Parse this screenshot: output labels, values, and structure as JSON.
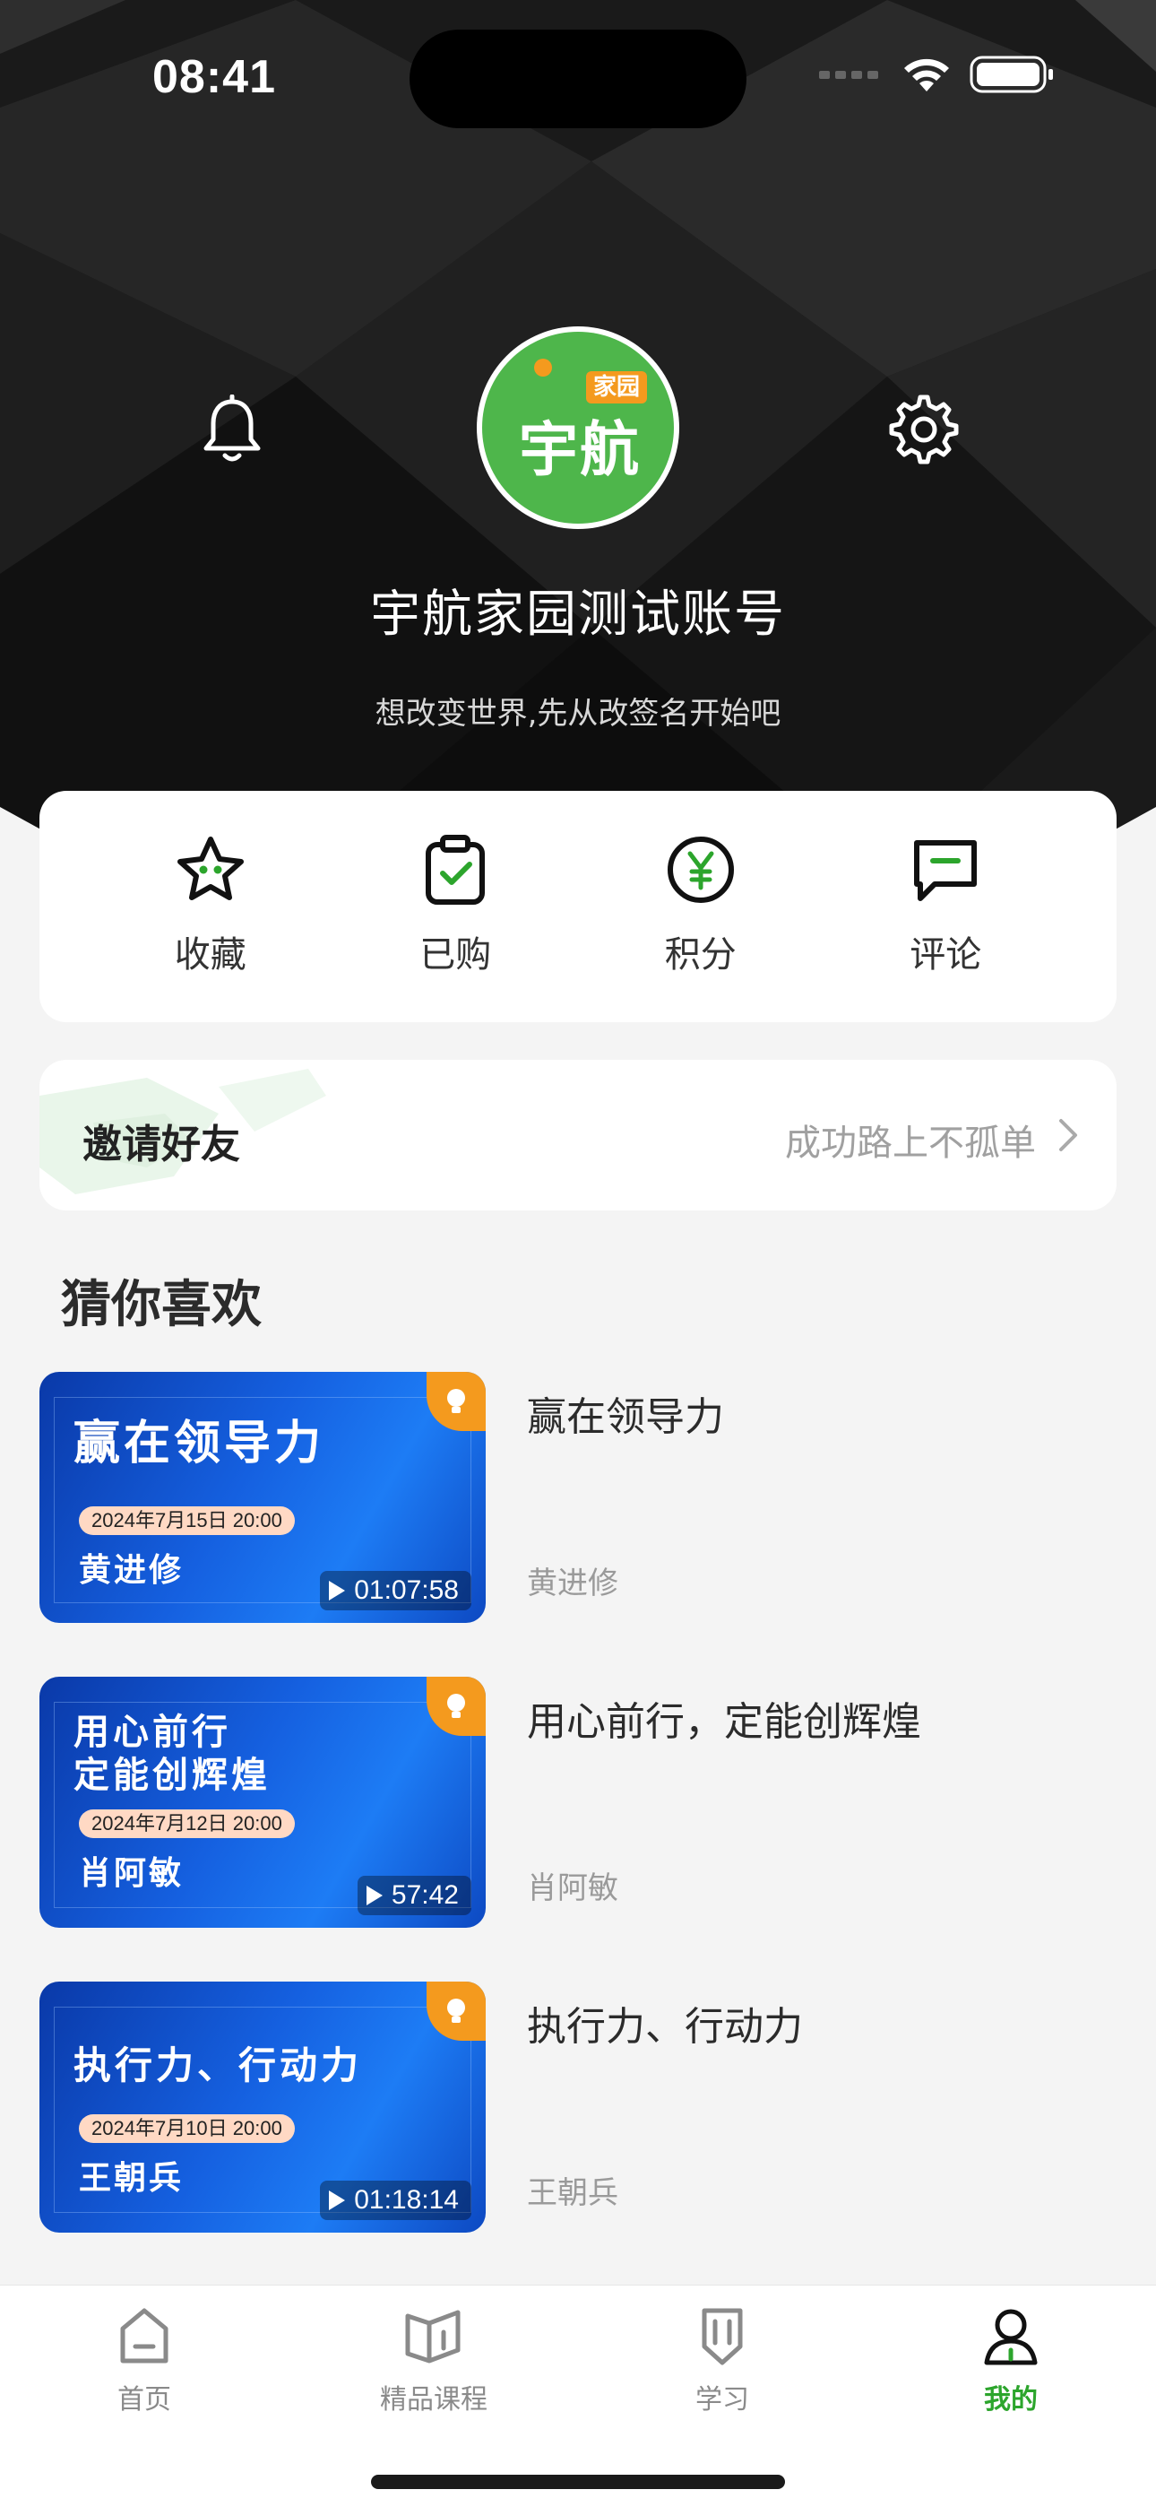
{
  "status_bar": {
    "time": "08:41"
  },
  "profile": {
    "avatar_text_top": "家园",
    "avatar_text_main": "宇航",
    "username": "宇航家园测试账号",
    "signature": "想改变世界,先从改签名开始吧"
  },
  "quick_actions": [
    {
      "label": "收藏",
      "icon": "star-icon"
    },
    {
      "label": "已购",
      "icon": "clipboard-check-icon"
    },
    {
      "label": "积分",
      "icon": "yen-coin-icon"
    },
    {
      "label": "评论",
      "icon": "comment-icon"
    }
  ],
  "invite": {
    "title": "邀请好友",
    "subtitle": "成功路上不孤单"
  },
  "recommend": {
    "title": "猜你喜欢",
    "courses": [
      {
        "thumb_title_1": "赢在领导力",
        "thumb_title_2": "",
        "date": "2024年7月15日  20:00",
        "thumb_lecturer": "黄进修",
        "duration": "01:07:58",
        "title": "赢在领导力",
        "lecturer": "黄进修"
      },
      {
        "thumb_title_1": "用心前行",
        "thumb_title_2": "定能创辉煌",
        "date": "2024年7月12日  20:00",
        "thumb_lecturer": "肖阿敏",
        "duration": "57:42",
        "title": "用心前行，定能创辉煌",
        "lecturer": "肖阿敏"
      },
      {
        "thumb_title_1": "执行力、行动力",
        "thumb_title_2": "",
        "date": "2024年7月10日  20:00",
        "thumb_lecturer": "王朝兵",
        "duration": "01:18:14",
        "title": "执行力、行动力",
        "lecturer": "王朝兵"
      }
    ]
  },
  "tabs": [
    {
      "label": "首页",
      "icon": "home-icon",
      "active": false
    },
    {
      "label": "精品课程",
      "icon": "book-icon",
      "active": false
    },
    {
      "label": "学习",
      "icon": "bookmark-pen-icon",
      "active": false
    },
    {
      "label": "我的",
      "icon": "user-icon",
      "active": true
    }
  ],
  "colors": {
    "accent": "#2ca52c",
    "avatar_green": "#4eb64b",
    "badge_orange": "#f49a1e"
  }
}
